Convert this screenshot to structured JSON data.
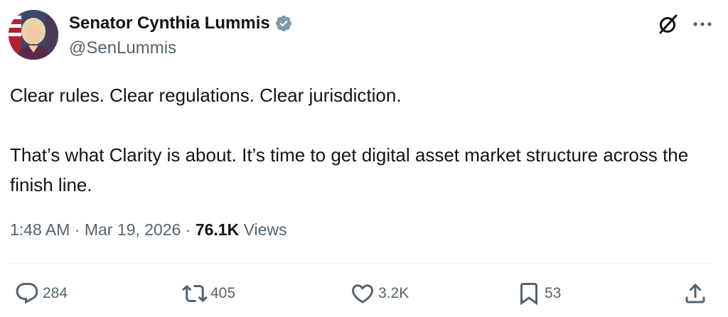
{
  "author": {
    "name": "Senator Cynthia Lummis",
    "handle": "@SenLummis"
  },
  "tweet": {
    "line1": "Clear rules. Clear regulations. Clear jurisdiction.",
    "line2": "That’s what Clarity is about. It’s time to get digital asset market structure across the finish line."
  },
  "meta": {
    "time": "1:48 AM",
    "sep1": " · ",
    "date": "Mar 19, 2026",
    "sep2": " · ",
    "views_count": "76.1K",
    "views_label": " Views"
  },
  "actions": {
    "replies": "284",
    "reposts": "405",
    "likes": "3.2K",
    "bookmarks": "53"
  },
  "icons": {
    "verified": "verified-badge-icon",
    "grok": "grok-icon",
    "more": "more-icon",
    "reply": "reply-icon",
    "repost": "repost-icon",
    "like": "like-icon",
    "bookmark": "bookmark-icon",
    "share": "share-icon"
  },
  "colors": {
    "text": "#0f1419",
    "secondary": "#536471",
    "verified": "#829aab",
    "divider": "#eff3f4"
  }
}
